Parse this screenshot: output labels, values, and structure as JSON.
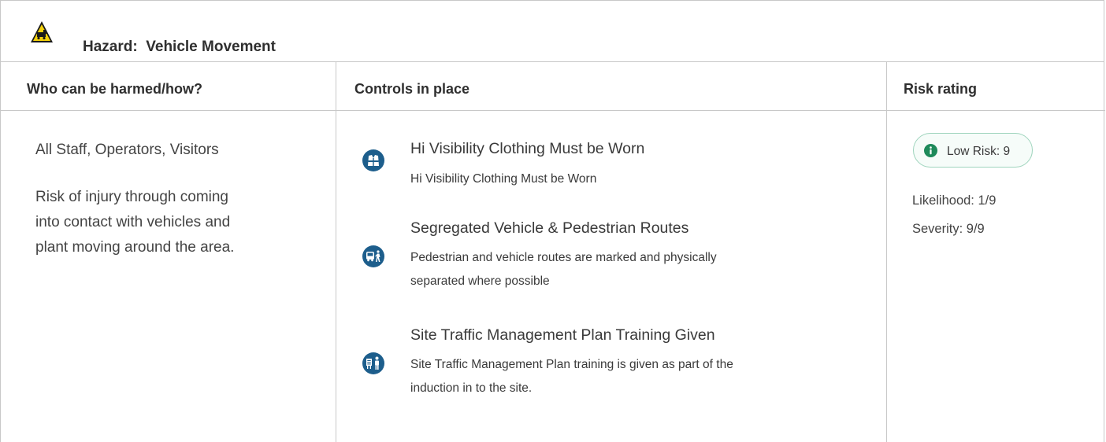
{
  "hazard": {
    "icon": "warning-vehicle-icon",
    "label": "Hazard:",
    "name": "Vehicle Movement"
  },
  "columns": {
    "who": "Who can be harmed/how?",
    "controls": "Controls in place",
    "risk": "Risk rating"
  },
  "who": {
    "people": "All Staff, Operators, Visitors",
    "risk_lines": [
      "Risk of injury through coming",
      "into contact with vehicles and",
      "plant moving around the area."
    ]
  },
  "controls": [
    {
      "icon": "hi-vis-vest-icon",
      "title": "Hi Visibility Clothing Must be Worn",
      "description_lines": [
        "Hi Visibility Clothing Must be Worn"
      ]
    },
    {
      "icon": "vehicle-pedestrian-icon",
      "title": "Segregated Vehicle & Pedestrian Routes",
      "description_lines": [
        "Pedestrian and vehicle routes are marked and physically",
        "separated where possible"
      ]
    },
    {
      "icon": "training-icon",
      "title": "Site Traffic Management Plan Training Given",
      "description_lines": [
        "Site Traffic Management Plan training is given as part of the",
        "induction in to the site."
      ]
    }
  ],
  "risk": {
    "badge": "Low Risk: 9",
    "likelihood": "Likelihood: 1/9",
    "severity": "Severity: 9/9"
  },
  "colors": {
    "icon_blue": "#1d5e8c",
    "badge_green": "#1e8a5a",
    "warning_yellow": "#f4d10b",
    "border": "#c8c8c8"
  }
}
